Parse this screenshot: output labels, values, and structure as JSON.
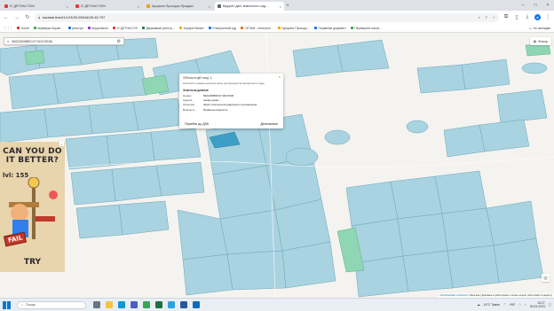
{
  "browser": {
    "tabs": [
      {
        "label": "ІС ДЕТНАС'ОЗ%",
        "color": "#e53935",
        "active": false
      },
      {
        "label": "ІС ДЕТНАС'ОЗ%",
        "color": "#e53935",
        "active": false
      },
      {
        "label": "Аукціони Прозорро.Продажі",
        "color": "#f4a100",
        "active": false
      },
      {
        "label": "Відкриті дані земельного кад…",
        "color": "#5f6368",
        "active": true
      }
    ],
    "url": "kadastr.live/#14.03/20.05544/28.45.797",
    "bookmarks": [
      {
        "label": "Gmail",
        "color": "#d93025"
      },
      {
        "label": "перевірка боржн…",
        "color": "#34a853"
      },
      {
        "label": "реєстри",
        "color": "#1a73e8"
      },
      {
        "label": "нерухомість",
        "color": "#9334e6"
      },
      {
        "label": "ІС ДЕТНАС'ОЗ",
        "color": "#e53935"
      },
      {
        "label": "Державний реєстр…",
        "color": "#188038"
      },
      {
        "label": "Аграрні банкет",
        "color": "#f9ab00"
      },
      {
        "label": "Електронний суд",
        "color": "#1a73e8"
      },
      {
        "label": "СЕТАМ - електрон…",
        "color": "#e8710a"
      },
      {
        "label": "Аукціони Прозорр…",
        "color": "#f4a100"
      },
      {
        "label": "Порівнюю документ",
        "color": "#1a73e8"
      },
      {
        "label": "Перевірити паспо…",
        "color": "#34a853"
      }
    ],
    "all_bookmarks": "Усі закладки"
  },
  "map": {
    "search_value": "5621083800:07:002:0036",
    "filter_label": "Фільтр",
    "popup": {
      "title": "Об'єкти в цій точці: 1",
      "warning": "Натисніть правою кнопкою миші для фіксації встановленого шару",
      "section": "Земельна ділянка",
      "rows": [
        {
          "k": "Номер",
          "v": "5621083800:07:002:0036"
        },
        {
          "k": "Адреса",
          "v": "немає даних"
        },
        {
          "k": "Категорія",
          "v": "Землі сільськогосподарського призначення"
        },
        {
          "k": "Власність",
          "v": "Приватна власність"
        }
      ],
      "dzk_button": "Перейти до ДЗК",
      "details_button": "Детальніше"
    },
    "attribution_link": "OpenStreetMap contributors",
    "attribution_text": "| Мапа фон | Державна служба України з питань геодезії, картографії та кадастру"
  },
  "ad": {
    "headline": "CAN YOU DO IT BETTER?",
    "level": "lvl: 155",
    "fail": "FAIL",
    "cta": "TRY"
  },
  "taskbar": {
    "search_placeholder": "Пошук",
    "weather": "16°C Туман",
    "lang": "УКР",
    "time": "15:27",
    "date": "30.04.2023"
  }
}
